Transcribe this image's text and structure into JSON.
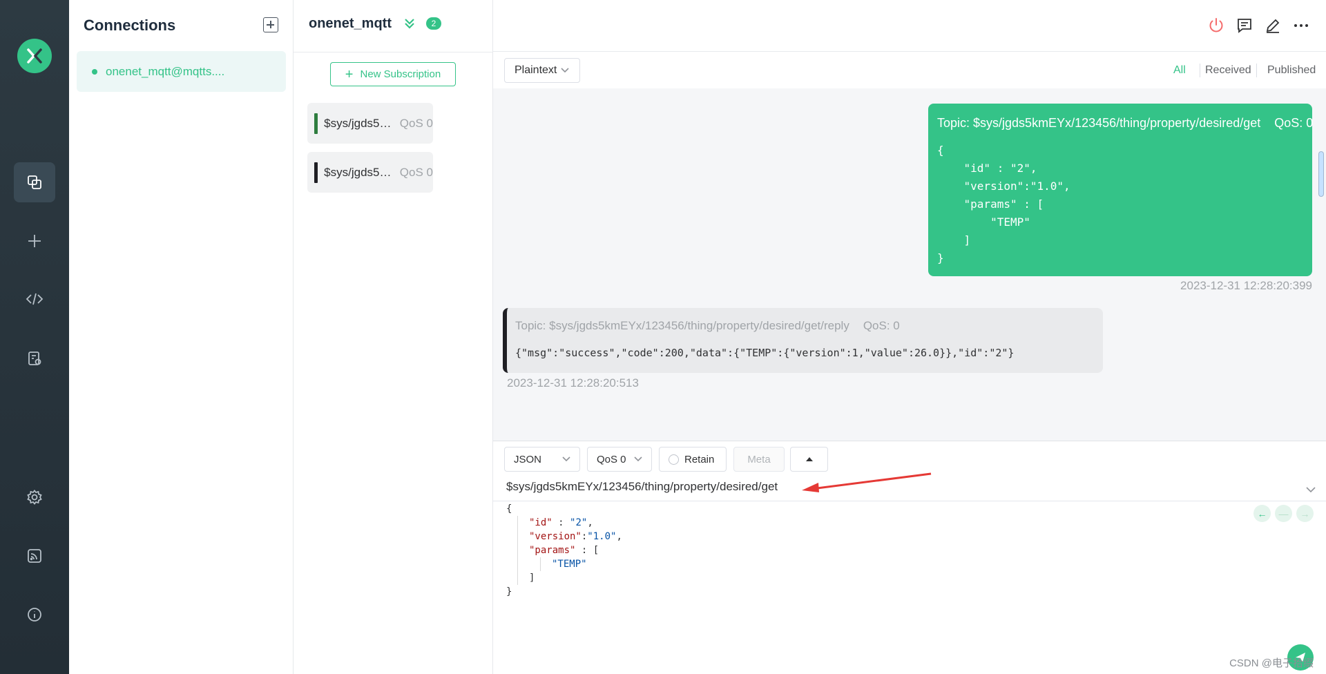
{
  "app": {
    "accent_color": "#34c388"
  },
  "rail": {
    "items": [
      {
        "name": "connections",
        "icon": "copy-icon",
        "active": true
      },
      {
        "name": "new-connection",
        "icon": "plus-icon"
      },
      {
        "name": "script",
        "icon": "code-icon"
      },
      {
        "name": "log",
        "icon": "log-icon"
      },
      {
        "name": "settings",
        "icon": "gear-icon"
      },
      {
        "name": "benchmark",
        "icon": "rss-icon"
      },
      {
        "name": "about",
        "icon": "info-icon"
      }
    ]
  },
  "connections": {
    "title": "Connections",
    "items": [
      {
        "label": "onenet_mqtt@mqtts....",
        "status": "connected"
      }
    ]
  },
  "header": {
    "title": "onenet_mqtt",
    "badge_count": "2",
    "icons": [
      "power-icon",
      "message-icon",
      "edit-icon",
      "more-icon"
    ]
  },
  "subscriptions": {
    "new_button": "New Subscription",
    "items": [
      {
        "topic": "$sys/jgds5kmEYx/123456/thing/property/desired/get/reply",
        "qos": "QoS 0",
        "color": "#2e7d3f"
      },
      {
        "topic": "$sys/jgds5kmEYx/123456/thing/property/desired/get",
        "qos": "QoS 0",
        "color": "#1f1f24"
      }
    ]
  },
  "messages": {
    "format": "Plaintext",
    "filters": {
      "all": "All",
      "received": "Received",
      "published": "Published"
    },
    "outgoing": {
      "topic": "Topic: $sys/jgds5kmEYx/123456/thing/property/desired/get",
      "qos": "QoS: 0",
      "payload": "{\n    \"id\" : \"2\",\n    \"version\":\"1.0\",\n    \"params\" : [\n        \"TEMP\"\n    ]\n}",
      "time": "2023-12-31 12:28:20:399"
    },
    "incoming": {
      "topic": "Topic: $sys/jgds5kmEYx/123456/thing/property/desired/get/reply",
      "qos": "QoS: 0",
      "payload": "{\"msg\":\"success\",\"code\":200,\"data\":{\"TEMP\":{\"version\":1,\"value\":26.0}},\"id\":\"2\"}",
      "time": "2023-12-31 12:28:20:513"
    }
  },
  "publish": {
    "format": "JSON",
    "qos": "QoS 0",
    "retain": "Retain",
    "meta": "Meta",
    "topic": "$sys/jgds5kmEYx/123456/thing/property/desired/get",
    "payload_lines": {
      "open": "{",
      "id_key": "\"id\"",
      "id_sep": " : ",
      "id_val": "\"2\"",
      "version_key": "\"version\"",
      "version_sep": ":",
      "version_val": "\"1.0\"",
      "params_key": "\"params\"",
      "params_sep": " : [",
      "temp_val": "\"TEMP\"",
      "arr_close": "]",
      "close": "}"
    }
  },
  "watermark": "CSDN @电子拾缀"
}
